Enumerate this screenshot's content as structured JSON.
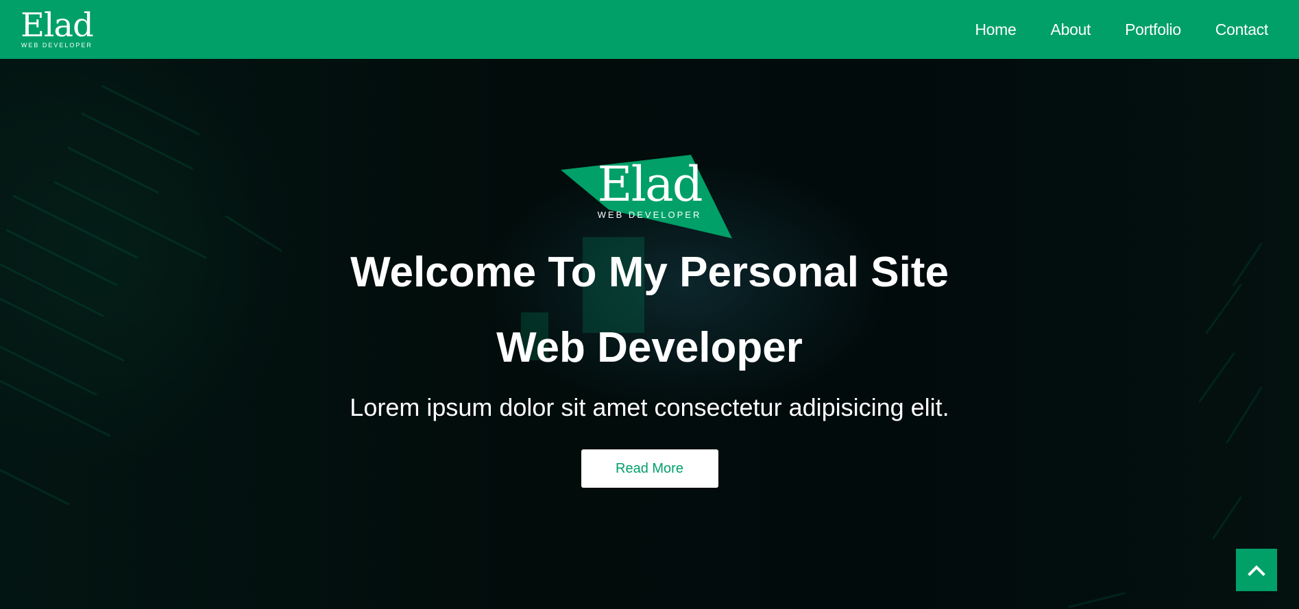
{
  "navbar": {
    "brand_name": "Elad",
    "brand_sub": "WEB DEVELOPER",
    "links": [
      {
        "label": "Home"
      },
      {
        "label": "About"
      },
      {
        "label": "Portfolio"
      },
      {
        "label": "Contact"
      }
    ]
  },
  "hero": {
    "logo_name": "Elad",
    "logo_sub": "WEB DEVELOPER",
    "title": "Welcome To My Personal Site",
    "subtitle": "Web Developer",
    "text": "Lorem ipsum dolor sit amet consectetur adipisicing elit.",
    "button_label": "Read More"
  },
  "scroll_top": {
    "icon": "chevron-up-icon"
  },
  "colors": {
    "brand_green": "#00a068",
    "hero_bg": "#020c0b",
    "text_white": "#ffffff"
  }
}
